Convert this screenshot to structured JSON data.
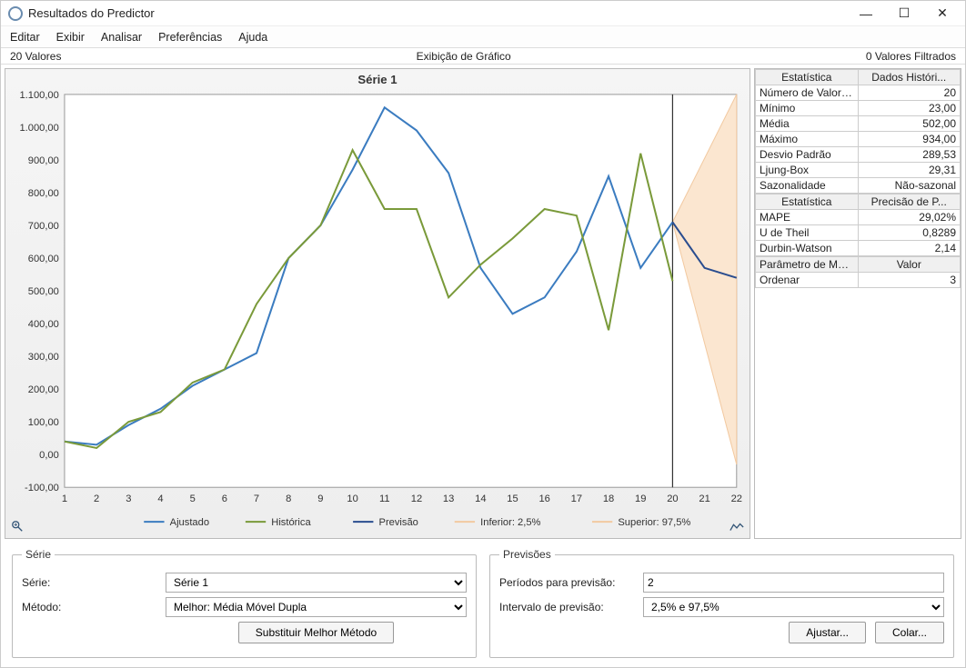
{
  "window_title": "Resultados do Predictor",
  "menu": {
    "edit": "Editar",
    "view": "Exibir",
    "analyze": "Analisar",
    "prefs": "Preferências",
    "help": "Ajuda"
  },
  "status": {
    "left": "20 Valores",
    "center": "Exibição de Gráfico",
    "right": "0 Valores Filtrados"
  },
  "chart_data": {
    "type": "line",
    "title": "Série 1",
    "x": [
      1,
      2,
      3,
      4,
      5,
      6,
      7,
      8,
      9,
      10,
      11,
      12,
      13,
      14,
      15,
      16,
      17,
      18,
      19,
      20,
      21,
      22
    ],
    "y_ticks": [
      -100,
      0,
      100,
      200,
      300,
      400,
      500,
      600,
      700,
      800,
      900,
      1000,
      1100
    ],
    "y_tick_labels": [
      "-100,00",
      "0,00",
      "100,00",
      "200,00",
      "300,00",
      "400,00",
      "500,00",
      "600,00",
      "700,00",
      "800,00",
      "900,00",
      "1.000,00",
      "1.100,00"
    ],
    "ylim": [
      -100,
      1100
    ],
    "series": [
      {
        "name": "Ajustado",
        "color": "#3b7cc0",
        "x": [
          1,
          2,
          3,
          4,
          5,
          6,
          7,
          8,
          9,
          10,
          11,
          12,
          13,
          14,
          15,
          16,
          17,
          18,
          19,
          20
        ],
        "y": [
          40,
          30,
          90,
          140,
          210,
          260,
          310,
          600,
          700,
          870,
          1060,
          990,
          860,
          570,
          430,
          480,
          620,
          850,
          570,
          710
        ]
      },
      {
        "name": "Histórica",
        "color": "#7a9a3a",
        "x": [
          1,
          2,
          3,
          4,
          5,
          6,
          7,
          8,
          9,
          10,
          11,
          12,
          13,
          14,
          15,
          16,
          17,
          18,
          19,
          20
        ],
        "y": [
          40,
          20,
          100,
          130,
          220,
          260,
          460,
          600,
          700,
          930,
          750,
          750,
          480,
          580,
          660,
          750,
          730,
          380,
          920,
          530
        ]
      },
      {
        "name": "Previsão",
        "color": "#2a4d8f",
        "x": [
          20,
          21,
          22
        ],
        "y": [
          710,
          570,
          540
        ]
      },
      {
        "name": "Inferior: 2,5%",
        "color": "#f2c9a0",
        "x": [
          20,
          22
        ],
        "y": [
          710,
          -30
        ]
      },
      {
        "name": "Superior: 97,5%",
        "color": "#f2c9a0",
        "x": [
          20,
          22
        ],
        "y": [
          710,
          1100
        ]
      }
    ],
    "legend": [
      "Ajustado",
      "Histórica",
      "Previsão",
      "Inferior: 2,5%",
      "Superior: 97,5%"
    ],
    "vline_x": 20
  },
  "stats1_headers": [
    "Estatística",
    "Dados Históri..."
  ],
  "stats1": [
    [
      "Número de Valores ...",
      "20"
    ],
    [
      "Mínimo",
      "23,00"
    ],
    [
      "Média",
      "502,00"
    ],
    [
      "Máximo",
      "934,00"
    ],
    [
      "Desvio Padrão",
      "289,53"
    ],
    [
      "Ljung-Box",
      "29,31"
    ],
    [
      "Sazonalidade",
      "Não-sazonal"
    ]
  ],
  "stats2_headers": [
    "Estatística",
    "Precisão de P..."
  ],
  "stats2": [
    [
      "MAPE",
      "29,02%"
    ],
    [
      "U de Theil",
      "0,8289"
    ],
    [
      "Durbin-Watson",
      "2,14"
    ]
  ],
  "stats3_headers": [
    "Parâmetro de Mét...",
    "Valor"
  ],
  "stats3": [
    [
      "Ordenar",
      "3"
    ]
  ],
  "serie_section": {
    "legend": "Série",
    "serie_label": "Série:",
    "serie_value": "Série 1",
    "metodo_label": "Método:",
    "metodo_value": "Melhor: Média Móvel Dupla",
    "button": "Substituir Melhor Método"
  },
  "prev_section": {
    "legend": "Previsões",
    "periodos_label": "Períodos para previsão:",
    "periodos_value": "2",
    "intervalo_label": "Intervalo de previsão:",
    "intervalo_value": "2,5% e 97,5%",
    "ajustar": "Ajustar...",
    "colar": "Colar..."
  }
}
